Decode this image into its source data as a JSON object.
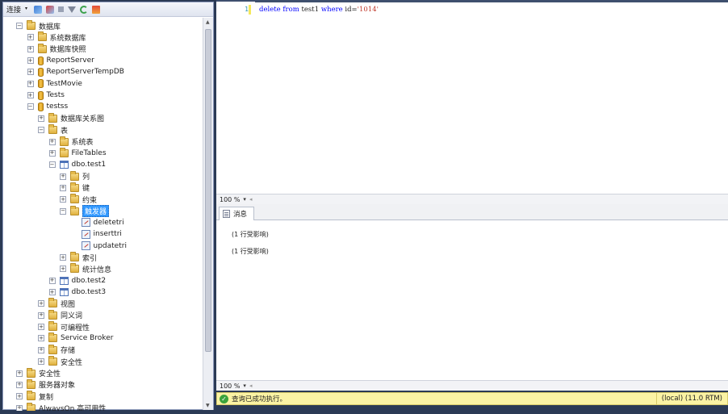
{
  "object_explorer": {
    "toolbar": {
      "connect_label": "连接"
    },
    "tree": [
      {
        "label": "数据库",
        "icon": "folder",
        "indent": 0,
        "state": "expanded"
      },
      {
        "label": "系统数据库",
        "icon": "folder",
        "indent": 1,
        "state": "collapsed"
      },
      {
        "label": "数据库快照",
        "icon": "folder",
        "indent": 1,
        "state": "collapsed"
      },
      {
        "label": "ReportServer",
        "icon": "database",
        "indent": 1,
        "state": "collapsed"
      },
      {
        "label": "ReportServerTempDB",
        "icon": "database",
        "indent": 1,
        "state": "collapsed"
      },
      {
        "label": "TestMovie",
        "icon": "database",
        "indent": 1,
        "state": "collapsed"
      },
      {
        "label": "Tests",
        "icon": "database",
        "indent": 1,
        "state": "collapsed"
      },
      {
        "label": "testss",
        "icon": "database",
        "indent": 1,
        "state": "expanded"
      },
      {
        "label": "数据库关系图",
        "icon": "folder",
        "indent": 2,
        "state": "collapsed"
      },
      {
        "label": "表",
        "icon": "folder",
        "indent": 2,
        "state": "expanded"
      },
      {
        "label": "系统表",
        "icon": "folder",
        "indent": 3,
        "state": "collapsed"
      },
      {
        "label": "FileTables",
        "icon": "folder",
        "indent": 3,
        "state": "collapsed"
      },
      {
        "label": "dbo.test1",
        "icon": "table",
        "indent": 3,
        "state": "expanded"
      },
      {
        "label": "列",
        "icon": "folder",
        "indent": 4,
        "state": "collapsed"
      },
      {
        "label": "键",
        "icon": "folder",
        "indent": 4,
        "state": "collapsed"
      },
      {
        "label": "约束",
        "icon": "folder",
        "indent": 4,
        "state": "collapsed"
      },
      {
        "label": "触发器",
        "icon": "folder",
        "indent": 4,
        "state": "expanded",
        "selected": true
      },
      {
        "label": "deletetri",
        "icon": "trigger",
        "indent": 5,
        "state": "leaf"
      },
      {
        "label": "inserttri",
        "icon": "trigger",
        "indent": 5,
        "state": "leaf"
      },
      {
        "label": "updatetri",
        "icon": "trigger",
        "indent": 5,
        "state": "leaf"
      },
      {
        "label": "索引",
        "icon": "folder",
        "indent": 4,
        "state": "collapsed"
      },
      {
        "label": "统计信息",
        "icon": "folder",
        "indent": 4,
        "state": "collapsed"
      },
      {
        "label": "dbo.test2",
        "icon": "table",
        "indent": 3,
        "state": "collapsed"
      },
      {
        "label": "dbo.test3",
        "icon": "table",
        "indent": 3,
        "state": "collapsed"
      },
      {
        "label": "视图",
        "icon": "folder",
        "indent": 2,
        "state": "collapsed"
      },
      {
        "label": "同义词",
        "icon": "folder",
        "indent": 2,
        "state": "collapsed"
      },
      {
        "label": "可编程性",
        "icon": "folder",
        "indent": 2,
        "state": "collapsed"
      },
      {
        "label": "Service Broker",
        "icon": "folder",
        "indent": 2,
        "state": "collapsed"
      },
      {
        "label": "存储",
        "icon": "folder",
        "indent": 2,
        "state": "collapsed"
      },
      {
        "label": "安全性",
        "icon": "folder",
        "indent": 2,
        "state": "collapsed"
      },
      {
        "label": "安全性",
        "icon": "folder",
        "indent": 0,
        "state": "collapsed"
      },
      {
        "label": "服务器对象",
        "icon": "folder",
        "indent": 0,
        "state": "collapsed"
      },
      {
        "label": "复制",
        "icon": "folder",
        "indent": 0,
        "state": "collapsed"
      },
      {
        "label": "AlwaysOn 高可用性",
        "icon": "folder",
        "indent": 0,
        "state": "collapsed"
      }
    ]
  },
  "editor": {
    "line_number": "1",
    "code_tokens": [
      {
        "text": "delete",
        "kind": "kw"
      },
      {
        "text": " ",
        "kind": "plain"
      },
      {
        "text": "from",
        "kind": "kw"
      },
      {
        "text": " test1 ",
        "kind": "plain"
      },
      {
        "text": "where",
        "kind": "kw"
      },
      {
        "text": " id=",
        "kind": "plain"
      },
      {
        "text": "'1014'",
        "kind": "str"
      }
    ],
    "zoom": "100 %"
  },
  "results": {
    "tab_label": "消息",
    "messages": [
      "(1 行受影响)",
      "(1 行受影响)"
    ],
    "zoom": "100 %"
  },
  "status": {
    "text": "查询已成功执行。",
    "server": "(local) (11.0 RTM)",
    "bar_color": "#fbf3a4"
  }
}
